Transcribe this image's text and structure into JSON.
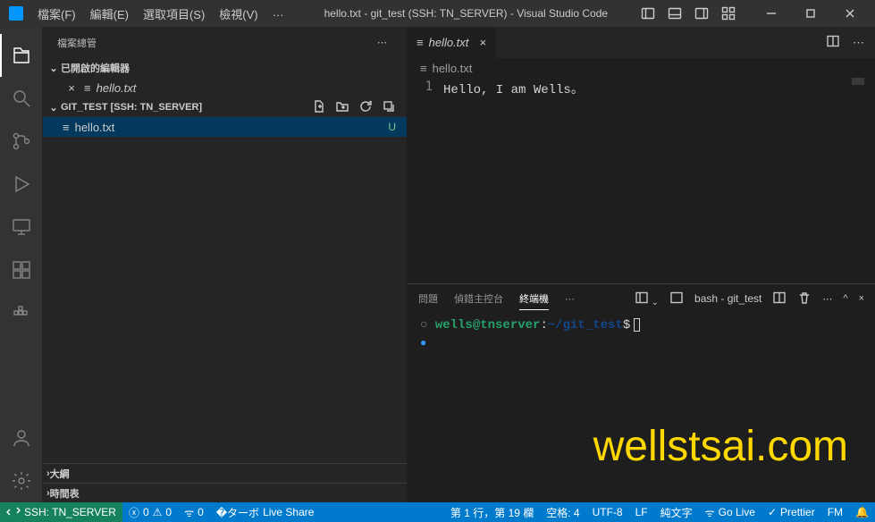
{
  "titlebar": {
    "menus": [
      "檔案(F)",
      "編輯(E)",
      "選取項目(S)",
      "檢視(V)",
      "…"
    ],
    "title": "hello.txt - git_test (SSH: TN_SERVER) - Visual Studio Code"
  },
  "sidebar": {
    "title": "檔案總管",
    "openEditors": {
      "label": "已開啟的編輯器",
      "items": [
        {
          "name": "hello.txt"
        }
      ]
    },
    "folder": {
      "label": "GIT_TEST [SSH: TN_SERVER]",
      "items": [
        {
          "name": "hello.txt",
          "status": "U"
        }
      ]
    },
    "outline": "大綱",
    "timeline": "時間表"
  },
  "editor": {
    "tab": {
      "name": "hello.txt"
    },
    "breadcrumb": "hello.txt",
    "lineNum": "1",
    "lineText": "Hello, I am Wells。"
  },
  "panel": {
    "tabs": {
      "problems": "問題",
      "debug": "偵錯主控台",
      "terminal": "終端機"
    },
    "shell": "bash - git_test",
    "prompt": {
      "user": "wells@tnserver",
      "path": "~/git_test",
      "dollar": "$"
    },
    "watermark": "wellstsai.com"
  },
  "statusbar": {
    "remote": "SSH: TN_SERVER",
    "errors": "0",
    "warnings": "0",
    "ports": "0",
    "liveshare": "Live Share",
    "cursor": "第 1 行，第 19 欄",
    "spaces": "空格: 4",
    "encoding": "UTF-8",
    "eol": "LF",
    "lang": "純文字",
    "golive": "Go Live",
    "prettier": "Prettier",
    "fm": "FM",
    "bell": "🔔"
  }
}
